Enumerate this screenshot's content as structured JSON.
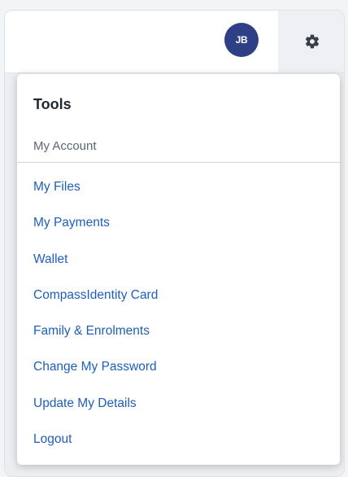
{
  "header": {
    "avatar_initials": "JB",
    "settings_icon": "gear-icon"
  },
  "menu": {
    "title": "Tools",
    "section_label": "My Account",
    "items": [
      {
        "label": "My Files"
      },
      {
        "label": "My Payments"
      },
      {
        "label": "Wallet"
      },
      {
        "label": "CompassIdentity Card"
      },
      {
        "label": "Family & Enrolments"
      },
      {
        "label": "Change My Password"
      },
      {
        "label": "Update My Details"
      },
      {
        "label": "Logout"
      }
    ]
  },
  "colors": {
    "link": "#1f5fb8",
    "avatar_bg": "#2f3f86",
    "title": "#222831",
    "section_label": "#5e656e"
  }
}
